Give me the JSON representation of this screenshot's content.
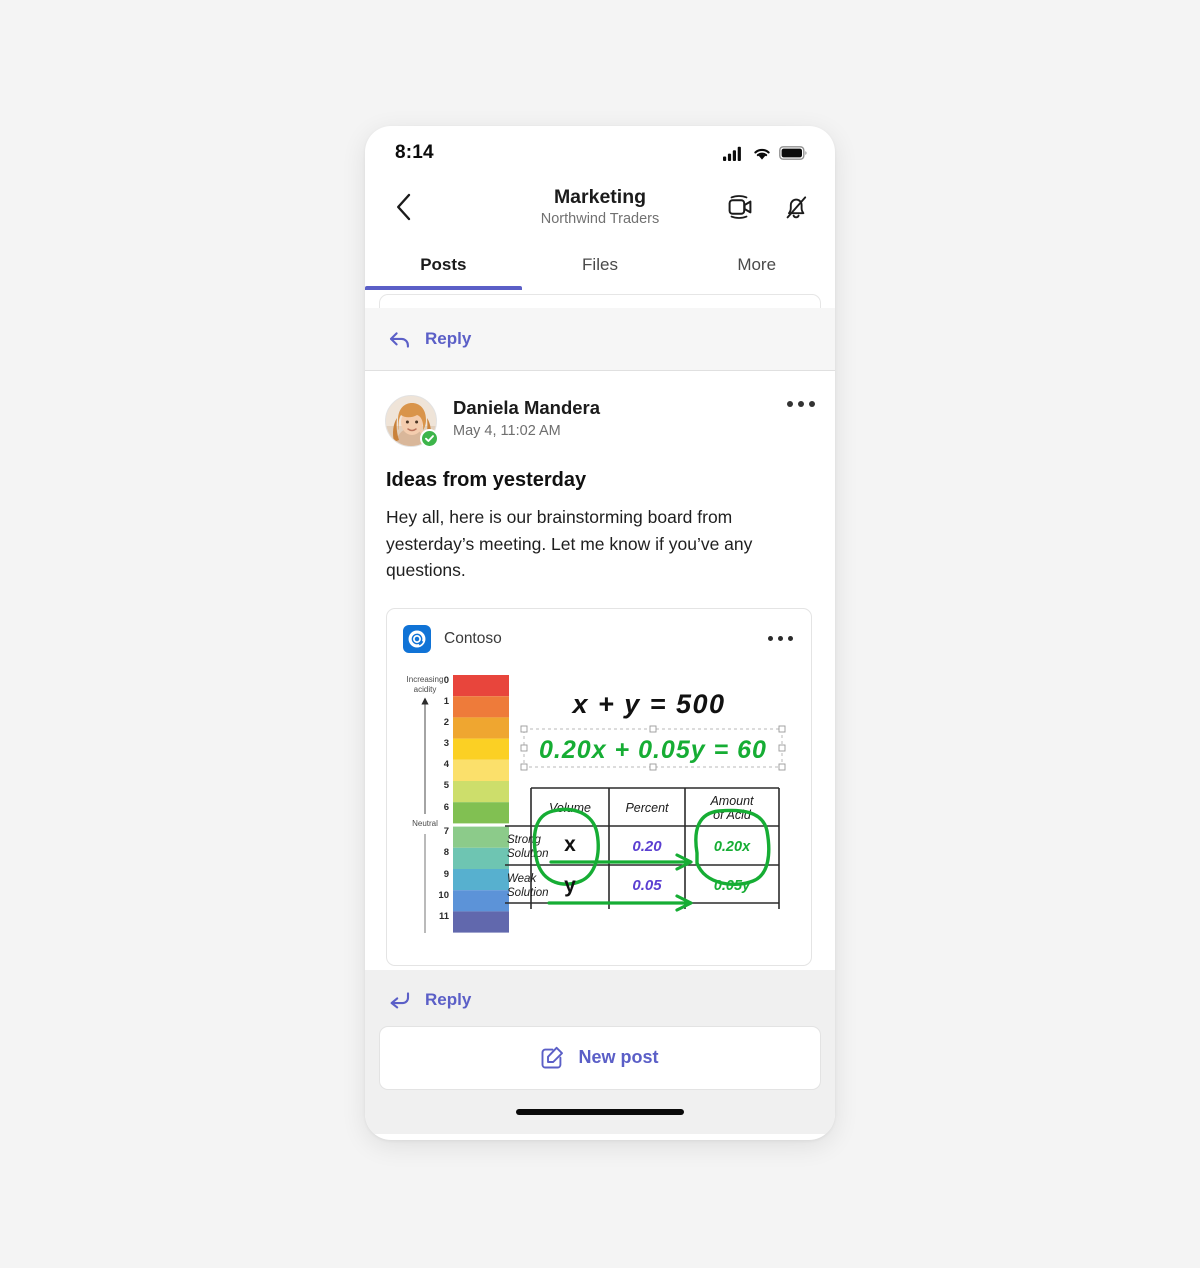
{
  "status_bar": {
    "time": "8:14",
    "icons": [
      "cellular-signal-icon",
      "wifi-icon",
      "battery-icon"
    ]
  },
  "channel_header": {
    "back_icon": "chevron-left-icon",
    "title": "Marketing",
    "subtitle": "Northwind Traders",
    "actions": [
      {
        "icon": "video-call-icon",
        "label": "Meet now"
      },
      {
        "icon": "bell-off-icon",
        "label": "Notifications off"
      }
    ]
  },
  "tabs": [
    {
      "label": "Posts",
      "active": true
    },
    {
      "label": "Files",
      "active": false
    },
    {
      "label": "More",
      "active": false
    }
  ],
  "reply_bar_top": {
    "icon": "reply-arrow-icon",
    "label": "Reply"
  },
  "post": {
    "author": "Daniela Mandera",
    "timestamp": "May 4, 11:02 AM",
    "presence": "available",
    "presence_icon": "checkmark-icon",
    "more_icon": "more-horizontal-icon",
    "title": "Ideas from yesterday",
    "body": "Hey all, here is our brainstorming board from yesterday’s meeting. Let me know if you’ve any questions.",
    "attachment": {
      "app_name": "Contoso",
      "app_icon": "contoso-logo-icon",
      "more_icon": "more-horizontal-icon",
      "whiteboard": {
        "ph_scale": {
          "top_label": "Increasing acidity",
          "middle_label": "Neutral",
          "ticks": [
            "0",
            "1",
            "2",
            "3",
            "4",
            "5",
            "6",
            "7",
            "8",
            "9",
            "10",
            "11"
          ],
          "colors": [
            "#e8453c",
            "#ee7b3a",
            "#efa630",
            "#fbd024",
            "#fbe06b",
            "#cdde6b",
            "#81c052",
            "#8ccb8a",
            "#6ec5b2",
            "#57b0cf",
            "#5c93d8",
            "#6168ad"
          ]
        },
        "equations": [
          {
            "text": "x + y = 500",
            "color": "#111111",
            "selected": false
          },
          {
            "text": "0.20x + 0.05y = 60",
            "color": "#16ad34",
            "selected": true
          }
        ],
        "table": {
          "columns": [
            "",
            "Volume",
            "Percent",
            "Amount of Acid"
          ],
          "rows": [
            {
              "label": "Strong Solution",
              "volume": "x",
              "percent": "0.20",
              "acid": "0.20x"
            },
            {
              "label": "Weak Solution",
              "volume": "y",
              "percent": "0.05",
              "acid": "0.05y"
            }
          ],
          "percent_color": "#5b3fd1",
          "acid_color": "#16ad34",
          "annotation_color": "#16ad34"
        }
      }
    }
  },
  "reply_bar_bottom": {
    "icon": "reply-curved-arrow-icon",
    "label": "Reply"
  },
  "new_post": {
    "icon": "compose-icon",
    "label": "New post"
  },
  "colors": {
    "brand_purple": "#5b5fc7",
    "presence_green": "#3db54a",
    "page_background": "#f4f4f4"
  }
}
